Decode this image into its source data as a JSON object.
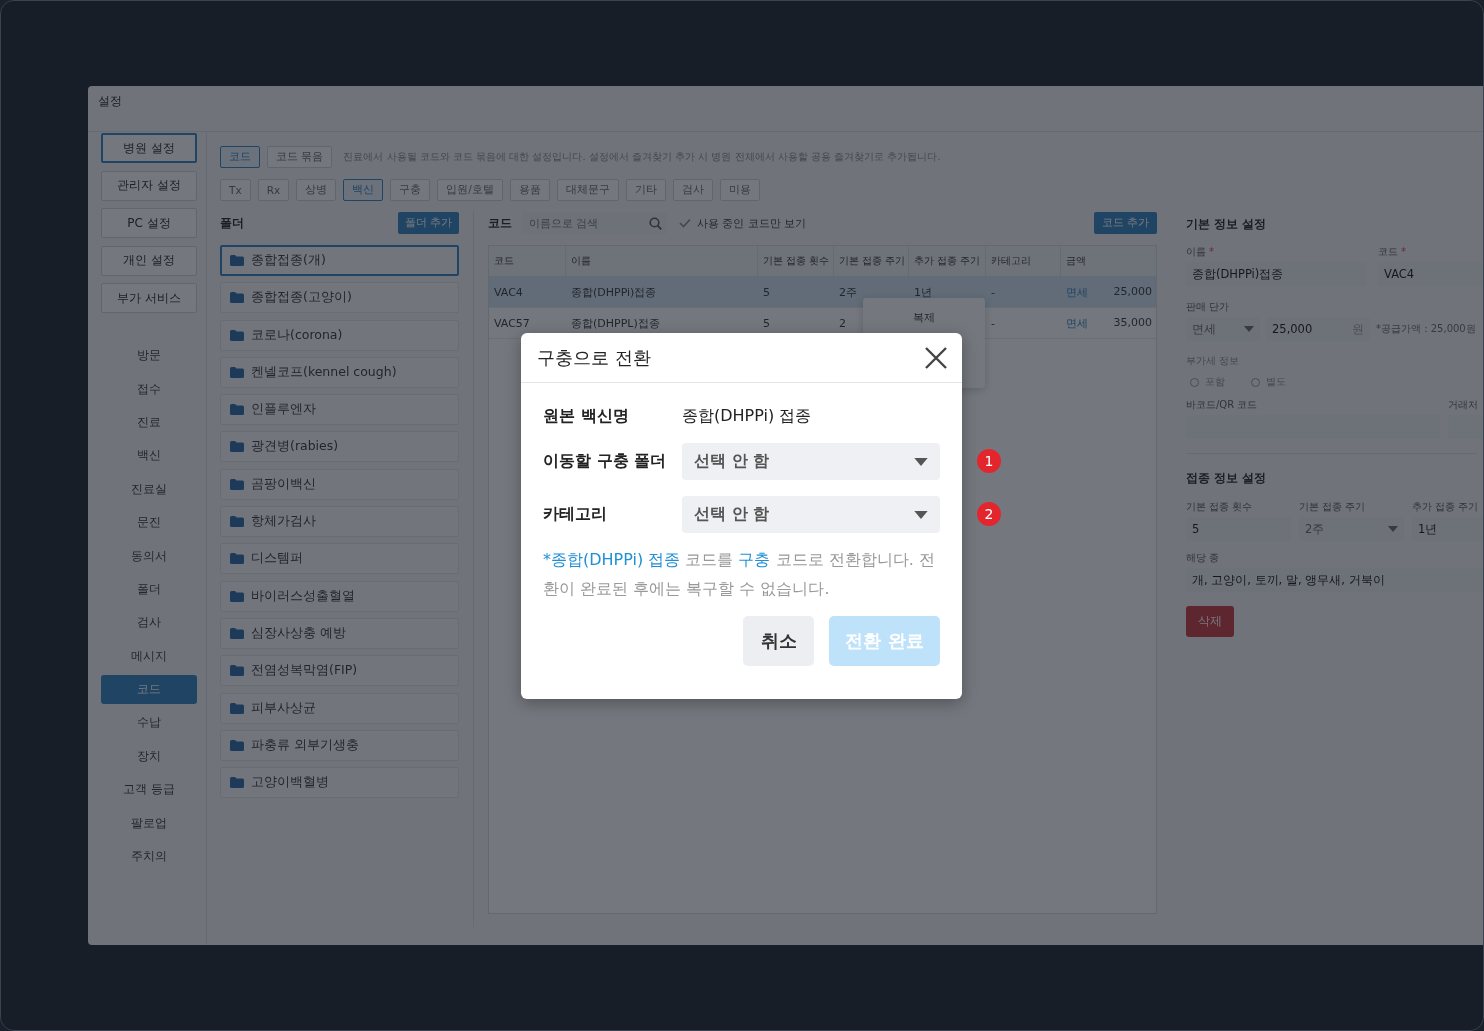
{
  "window": {
    "title": "설정"
  },
  "nav": {
    "top_buttons": [
      {
        "label": "병원 설정",
        "selected": true
      },
      {
        "label": "관리자 설정",
        "selected": false
      },
      {
        "label": "PC 설정",
        "selected": false
      },
      {
        "label": "개인 설정",
        "selected": false
      },
      {
        "label": "부가 서비스",
        "selected": false
      }
    ],
    "items": [
      {
        "label": "방문",
        "selected": false
      },
      {
        "label": "접수",
        "selected": false
      },
      {
        "label": "진료",
        "selected": false
      },
      {
        "label": "백신",
        "selected": false
      },
      {
        "label": "진료실",
        "selected": false
      },
      {
        "label": "문진",
        "selected": false
      },
      {
        "label": "동의서",
        "selected": false
      },
      {
        "label": "폴더",
        "selected": false
      },
      {
        "label": "검사",
        "selected": false
      },
      {
        "label": "메시지",
        "selected": false
      },
      {
        "label": "코드",
        "selected": true
      },
      {
        "label": "수납",
        "selected": false
      },
      {
        "label": "장치",
        "selected": false
      },
      {
        "label": "고객 등급",
        "selected": false
      },
      {
        "label": "팔로업",
        "selected": false
      },
      {
        "label": "주치의",
        "selected": false
      }
    ]
  },
  "view_tabs": [
    {
      "label": "코드",
      "selected": true
    },
    {
      "label": "코드 묶음",
      "selected": false
    }
  ],
  "description": "진료에서 사용될 코드와 코드 묶음에 대한 설정입니다. 설정에서 즐겨찾기 추가 시 병원 전체에서 사용할 공용 즐겨찾기로 추가됩니다.",
  "category_tabs": [
    {
      "label": "Tx",
      "selected": false
    },
    {
      "label": "Rx",
      "selected": false
    },
    {
      "label": "상병",
      "selected": false
    },
    {
      "label": "백신",
      "selected": true
    },
    {
      "label": "구충",
      "selected": false
    },
    {
      "label": "입원/호텔",
      "selected": false
    },
    {
      "label": "용품",
      "selected": false
    },
    {
      "label": "대체문구",
      "selected": false
    },
    {
      "label": "기타",
      "selected": false
    },
    {
      "label": "검사",
      "selected": false
    },
    {
      "label": "미용",
      "selected": false
    }
  ],
  "folders": {
    "title": "폴더",
    "add_button": "폴더 추가",
    "items": [
      {
        "label": "종합접종(개)",
        "selected": true
      },
      {
        "label": "종합접종(고양이)",
        "selected": false
      },
      {
        "label": "코로나(corona)",
        "selected": false
      },
      {
        "label": "켄넬코프(kennel cough)",
        "selected": false
      },
      {
        "label": "인플루엔자",
        "selected": false
      },
      {
        "label": "광견병(rabies)",
        "selected": false
      },
      {
        "label": "곰팡이백신",
        "selected": false
      },
      {
        "label": "항체가검사",
        "selected": false
      },
      {
        "label": "디스템퍼",
        "selected": false
      },
      {
        "label": "바이러스성출혈열",
        "selected": false
      },
      {
        "label": "심장사상충 예방",
        "selected": false
      },
      {
        "label": "전염성복막염(FIP)",
        "selected": false
      },
      {
        "label": "피부사상균",
        "selected": false
      },
      {
        "label": "파충류 외부기생충",
        "selected": false
      },
      {
        "label": "고양이백혈병",
        "selected": false
      }
    ]
  },
  "codes": {
    "title": "코드",
    "search": {
      "placeholder": "이름으로 검색"
    },
    "active_only": {
      "label": "사용 중인 코드만 보기",
      "checked": true
    },
    "add_button": "코드 추가",
    "columns": [
      "코드",
      "이름",
      "기본 접종 횟수",
      "기본 접종 주기",
      "추가 접종 주기",
      "카테고리",
      "금액"
    ],
    "rows": [
      {
        "selected": true,
        "code": "VAC4",
        "name": "종합(DHPPi)접종",
        "count": "5",
        "period": "2주",
        "extra_period": "1년",
        "category": "-",
        "tax": "면세",
        "amount": "25,000"
      },
      {
        "selected": false,
        "code": "VAC57",
        "name": "종합(DHPPL)접종",
        "count": "5",
        "period": "2",
        "category": "-",
        "tax": "면세",
        "amount": "35,000"
      }
    ]
  },
  "context_menu": {
    "items": [
      {
        "label": "복제"
      }
    ]
  },
  "detail": {
    "basic_title": "기본 정보 설정",
    "name": {
      "label": "이름",
      "required_mark": "*",
      "value": "종합(DHPPi)접종"
    },
    "code": {
      "label": "코드",
      "required_mark": "*",
      "value": "VAC4"
    },
    "price": {
      "label": "판매 단가",
      "tax_select": "면세",
      "value": "25,000",
      "unit": "원",
      "note": "*공급가액 : 25,000원"
    },
    "vat": {
      "label": "부가세 정보",
      "disabled": true,
      "options": [
        {
          "label": "포함",
          "selected": false
        },
        {
          "label": "별도",
          "selected": false
        }
      ]
    },
    "barcode": {
      "label": "바코드/QR 코드"
    },
    "vendor": {
      "label": "거래처"
    },
    "vaccine_title": "접종 정보 설정",
    "dose_count": {
      "label": "기본 접종 횟수",
      "value": "5"
    },
    "dose_period": {
      "label": "기본 접종 주기",
      "value": "2주"
    },
    "extra_period": {
      "label": "추가 접종 주기",
      "value": "1년"
    },
    "species": {
      "label": "해당 종",
      "value": "개, 고양이, 토끼, 말, 앵무새, 거북이"
    },
    "delete_button": "삭제"
  },
  "dialog": {
    "title": "구충으로 전환",
    "rows": [
      {
        "kind": "text",
        "label": "원본 백신명",
        "value": "종합(DHPPi) 접종"
      },
      {
        "kind": "select",
        "label": "이동할 구충 폴더",
        "value": "선택 안 함",
        "badge": "1"
      },
      {
        "kind": "select",
        "label": "카테고리",
        "value": "선택 안 함",
        "badge": "2"
      }
    ],
    "note": [
      {
        "text": "*종합(DHPPi) 접종",
        "highlight": true
      },
      {
        "text": " 코드를 ",
        "highlight": false
      },
      {
        "text": "구충",
        "highlight": true
      },
      {
        "text": " 코드로 전환합니다. 전환이 완료된 후에는 복구할 수 없습니다.",
        "highlight": false
      }
    ],
    "cancel_button": "취소",
    "confirm_button": {
      "label": "전환 완료",
      "disabled": true
    }
  }
}
